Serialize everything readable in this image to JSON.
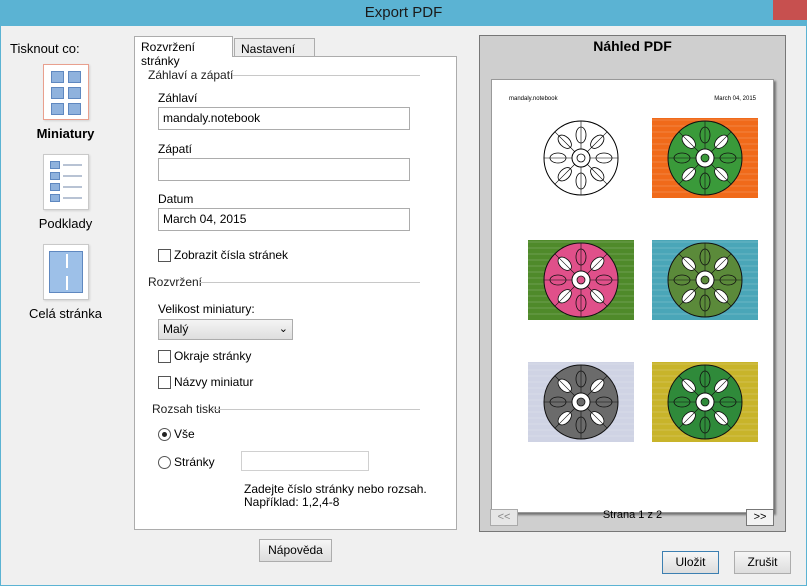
{
  "window": {
    "title": "Export PDF"
  },
  "print_target": {
    "label": "Tisknout co:",
    "options": [
      {
        "label": "Miniatury",
        "icon": "thumbnails-grid-icon",
        "selected": true
      },
      {
        "label": "Podklady",
        "icon": "handouts-icon",
        "selected": false
      },
      {
        "label": "Celá stránka",
        "icon": "full-page-icon",
        "selected": false
      }
    ]
  },
  "tabs": [
    {
      "label": "Rozvržení stránky",
      "active": true
    },
    {
      "label": "Nastavení PDF",
      "active": false
    }
  ],
  "header_footer": {
    "group_title": "Záhlaví a zápatí",
    "header_label": "Záhlaví",
    "header_value": "mandaly.notebook",
    "footer_label": "Zápatí",
    "footer_value": "",
    "date_label": "Datum",
    "date_value": "March 04, 2015",
    "show_page_numbers_label": "Zobrazit čísla stránek",
    "show_page_numbers": false
  },
  "layout": {
    "group_title": "Rozvržení",
    "thumb_size_label": "Velikost miniatury:",
    "thumb_size_value": "Malý",
    "page_borders_label": "Okraje stránky",
    "page_borders": false,
    "thumb_names_label": "Názvy miniatur",
    "thumb_names": false
  },
  "print_range": {
    "group_title": "Rozsah tisku",
    "all_label": "Vše",
    "pages_label": "Stránky",
    "selected": "all",
    "pages_value": "",
    "hint_line1": "Zadejte číslo stránky nebo rozsah.",
    "hint_line2": "Například: 1,2,4-8"
  },
  "buttons": {
    "help": "Nápověda",
    "save": "Uložit",
    "cancel": "Zrušit"
  },
  "preview": {
    "title": "Náhled PDF",
    "sheet_header_left": "mandaly.notebook",
    "sheet_header_right": "March 04, 2015",
    "prev_label": "<<",
    "next_label": ">>",
    "page_status": "Strana 1 z 2",
    "thumbnails": [
      {
        "name": "mandala-outline",
        "bg": "#ffffff",
        "accent": "#ffffff",
        "stroke": "#000000"
      },
      {
        "name": "mandala-orange",
        "bg": "#f06a1a",
        "accent": "#3a9a3a",
        "stroke": "#111111"
      },
      {
        "name": "mandala-pink-stripes",
        "bg": "#4f8a2a",
        "accent": "#e0508a",
        "stroke": "#111111"
      },
      {
        "name": "mandala-landscape",
        "bg": "#4aa6b8",
        "accent": "#5b8a3a",
        "stroke": "#111111"
      },
      {
        "name": "mandala-grey",
        "bg": "#cfd3e4",
        "accent": "#6b6b6b",
        "stroke": "#111111"
      },
      {
        "name": "mandala-gold",
        "bg": "#c8b42a",
        "accent": "#2f8a3a",
        "stroke": "#111111"
      }
    ]
  },
  "colors": {
    "titlebar": "#5bb3d3",
    "close_button": "#c7504f",
    "selected_tile_border": "#e9a08e",
    "default_button_border": "#3c7fb1"
  }
}
